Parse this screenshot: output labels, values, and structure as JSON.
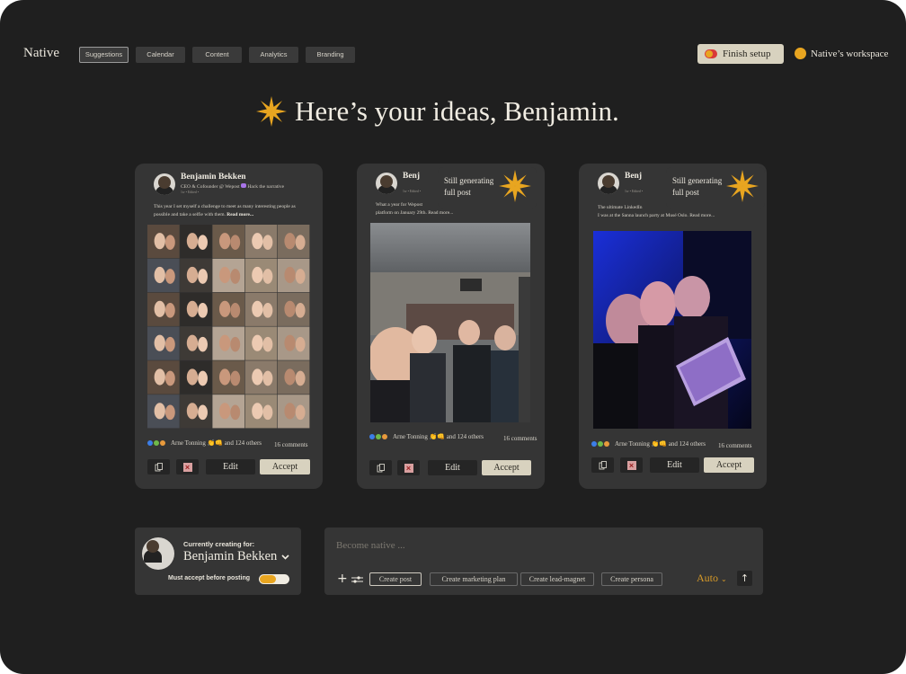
{
  "header": {
    "brand": "Native",
    "tabs": [
      "Suggestions",
      "Calendar",
      "Content",
      "Analytics",
      "Branding"
    ],
    "finish_setup": "Finish setup",
    "workspace": "Native’s workspace"
  },
  "heading": "Here’s your ideas, Benjamin.",
  "cards": [
    {
      "author": "Benjamin Bekken",
      "tagline": "CEO & Cofounder @ Wepost",
      "tagline_suffix": "Hack the narrative",
      "meta": "1w • Edited •",
      "body": "This year I set myself a challenge to meet as many interesting people as possible and take a selfie with them.",
      "read_more": "Read more...",
      "reactions": "Arne Tonning 👏👊 and 124 others",
      "comments": "16 comments"
    },
    {
      "author": "Benj",
      "meta": "1w • Edited •",
      "body_line1": "What a year for Wepost",
      "body_line2": "platform on January 29th.",
      "read_more": "Read more...",
      "generating_line1": "Still generating",
      "generating_line2": "full post",
      "reactions": "Arne Tonning 👏👊 and 124 others",
      "comments": "16 comments"
    },
    {
      "author": "Benj",
      "meta": "1w • Edited •",
      "body_line1": "The ultimate LinkedIn",
      "body_line2": "I was at the Sanna launch party at Musé Oslo.",
      "read_more": "Read more...",
      "generating_line1": "Still generating",
      "generating_line2": "full post",
      "reactions": "Arne Tonning 👏👊 and 124 others",
      "comments": "16 comments"
    }
  ],
  "actions": {
    "edit": "Edit",
    "accept": "Accept"
  },
  "creator": {
    "label": "Currently creating for:",
    "name": "Benjamin Bekken",
    "must_accept": "Must accept before posting"
  },
  "composer": {
    "placeholder": "Become native ...",
    "chips": [
      "Create post",
      "Create marketing plan",
      "Create lead-magnet",
      "Create persona"
    ],
    "mode": "Auto"
  },
  "colors": {
    "background": "#1f1f1f",
    "card": "#353535",
    "accent": "#e8a520",
    "accept": "#d8d2bf"
  }
}
